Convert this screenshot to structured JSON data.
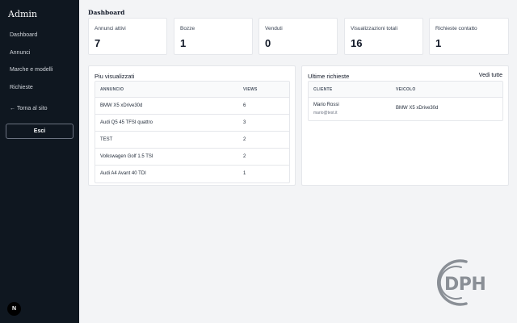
{
  "sidebar": {
    "brand": "Admin",
    "items": [
      {
        "label": "Dashboard"
      },
      {
        "label": "Annunci"
      },
      {
        "label": "Marche e modelli"
      },
      {
        "label": "Richieste"
      }
    ],
    "back_link": "← Torna al sito",
    "logout_label": "Esci",
    "badge": "N"
  },
  "page_title": "Dashboard",
  "stats": [
    {
      "label": "Annunci attivi",
      "value": "7"
    },
    {
      "label": "Bozze",
      "value": "1"
    },
    {
      "label": "Venduti",
      "value": "0"
    },
    {
      "label": "Visualizzazioni totali",
      "value": "16"
    },
    {
      "label": "Richieste contatto",
      "value": "1"
    }
  ],
  "most_viewed": {
    "title": "Piu visualizzati",
    "columns": [
      "Annuncio",
      "Views"
    ],
    "rows": [
      {
        "name": "BMW X5 xDrive30d",
        "views": "6"
      },
      {
        "name": "Audi Q5 45 TFSI quattro",
        "views": "3"
      },
      {
        "name": "TEST",
        "views": "2"
      },
      {
        "name": "Volkswagen Golf 1.5 TSI",
        "views": "2"
      },
      {
        "name": "Audi A4 Avant 40 TDI",
        "views": "1"
      }
    ]
  },
  "latest_requests": {
    "title": "Ultime richieste",
    "see_all": "Vedi tutte",
    "columns": [
      "Cliente",
      "Veicolo"
    ],
    "rows": [
      {
        "client": "Mario Rossi",
        "email": "mario@test.it",
        "vehicle": "BMW X5 xDrive30d"
      }
    ]
  },
  "watermark": {
    "text": "DPH",
    "color": "#8a8f96"
  }
}
